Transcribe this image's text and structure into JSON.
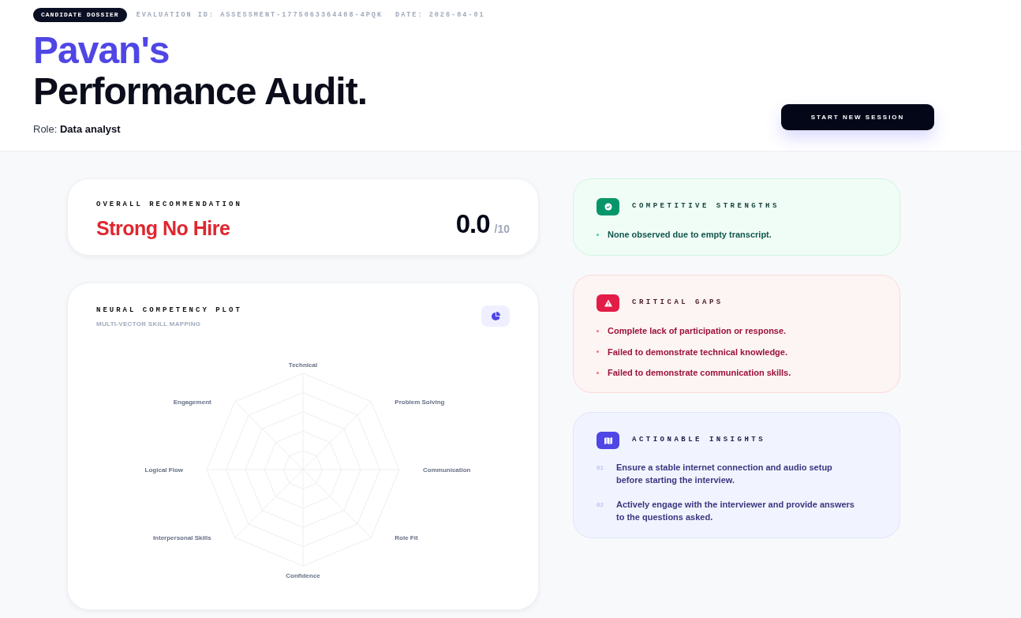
{
  "header": {
    "badge": "CANDIDATE DOSSIER",
    "evaluation_id": "EVALUATION ID: ASSESSMENT-1775063364408-4PQK",
    "date": "DATE: 2026-04-01",
    "title_name": "Pavan's",
    "title_rest": "Performance Audit.",
    "role": "Role: **Data analyst**",
    "button": "START NEW SESSION"
  },
  "recommendation": {
    "label": "OVERALL RECOMMENDATION",
    "verdict": "Strong No Hire",
    "score": "0.0",
    "score_max": "/10"
  },
  "competency_plot": {
    "title": "NEURAL COMPETENCY PLOT",
    "subtitle": "MULTI-VECTOR SKILL MAPPING",
    "axes": [
      {
        "label": "Technical",
        "kind": "n"
      },
      {
        "label": "Engagement",
        "kind": "nw"
      },
      {
        "label": "Problem Solving",
        "kind": "ne"
      },
      {
        "label": "Logical Flow",
        "kind": "w"
      },
      {
        "label": "Communication",
        "kind": "e"
      },
      {
        "label": "Interpersonal Skills",
        "kind": "sw"
      },
      {
        "label": "Role Fit",
        "kind": "se"
      },
      {
        "label": "Confidence",
        "kind": "s"
      }
    ]
  },
  "panels": [
    {
      "kind": "strengths",
      "title": "COMPETITIVE STRENGTHS",
      "items": [
        {
          "text": "None observed due to empty transcript."
        }
      ]
    },
    {
      "kind": "gaps",
      "title": "CRITICAL GAPS",
      "items": [
        {
          "text": "Complete lack of participation or response."
        },
        {
          "text": "Failed to demonstrate technical knowledge."
        },
        {
          "text": "Failed to demonstrate communication skills."
        }
      ]
    },
    {
      "kind": "insights",
      "title": "ACTIONABLE INSIGHTS",
      "items": [
        {
          "number": "01",
          "text": "Ensure a stable internet connection and audio setup before starting the interview."
        },
        {
          "number": "02",
          "text": "Actively engage with the interviewer and provide answers to the questions asked."
        }
      ]
    }
  ]
}
